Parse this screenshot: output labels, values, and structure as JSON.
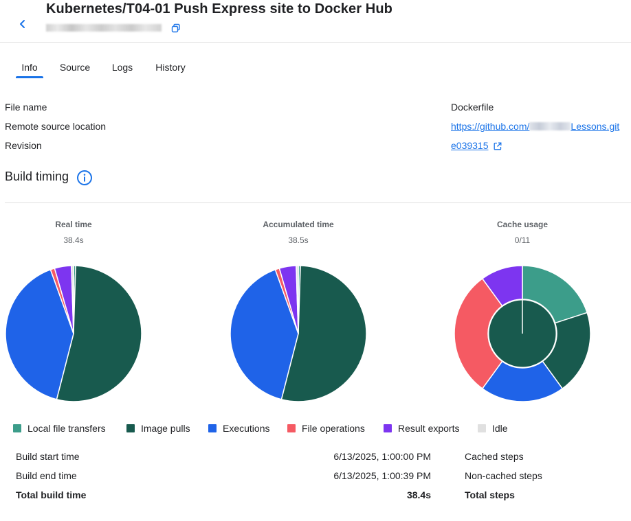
{
  "header": {
    "title": "Kubernetes/T04-01 Push Express site to Docker Hub"
  },
  "tabs": [
    {
      "label": "Info",
      "active": true
    },
    {
      "label": "Source",
      "active": false
    },
    {
      "label": "Logs",
      "active": false
    },
    {
      "label": "History",
      "active": false
    }
  ],
  "info": {
    "file_name_label": "File name",
    "file_name_value": "Dockerfile",
    "remote_label": "Remote source location",
    "remote_prefix": "https://github.com/",
    "remote_suffix": "Lessons.git",
    "revision_label": "Revision",
    "revision_value": "e039315"
  },
  "build_timing": {
    "title": "Build timing"
  },
  "colors": {
    "local_file_transfers": "#3c9d8a",
    "image_pulls": "#185a4e",
    "executions": "#1f63e8",
    "file_operations": "#f55a63",
    "result_exports": "#7d35f0",
    "idle": "#e0e0e0",
    "accent": "#1a73e8"
  },
  "chart_data": [
    {
      "type": "pie",
      "title": "Real time",
      "subtitle": "38.4s",
      "categories": [
        "Local file transfers",
        "Image pulls",
        "Executions",
        "File operations",
        "Result exports",
        "Idle"
      ],
      "values": [
        0.5,
        53.5,
        40.5,
        1.0,
        4.0,
        0.5
      ]
    },
    {
      "type": "pie",
      "title": "Accumulated time",
      "subtitle": "38.5s",
      "categories": [
        "Local file transfers",
        "Image pulls",
        "Executions",
        "File operations",
        "Result exports",
        "Idle"
      ],
      "values": [
        0.5,
        53.5,
        40.5,
        1.0,
        4.0,
        0.5
      ]
    },
    {
      "type": "pie",
      "title": "Cache usage",
      "subtitle": "0/11",
      "categories": [
        "Local file transfers",
        "Image pulls",
        "Executions",
        "File operations",
        "Result exports"
      ],
      "values": [
        2,
        2,
        2,
        3,
        1
      ],
      "inner": {
        "categories": [
          "Image pulls"
        ],
        "values": [
          1
        ]
      }
    }
  ],
  "legend": [
    {
      "label": "Local file transfers",
      "color": "#3c9d8a"
    },
    {
      "label": "Image pulls",
      "color": "#185a4e"
    },
    {
      "label": "Executions",
      "color": "#1f63e8"
    },
    {
      "label": "File operations",
      "color": "#f55a63"
    },
    {
      "label": "Result exports",
      "color": "#7d35f0"
    },
    {
      "label": "Idle",
      "color": "#e0e0e0"
    }
  ],
  "stats": {
    "start_label": "Build start time",
    "start_value": "6/13/2025, 1:00:00 PM",
    "end_label": "Build end time",
    "end_value": "6/13/2025, 1:00:39 PM",
    "total_label": "Total build time",
    "total_value": "38.4s",
    "cached_label": "Cached steps",
    "noncached_label": "Non-cached steps",
    "total_steps_label": "Total steps"
  }
}
